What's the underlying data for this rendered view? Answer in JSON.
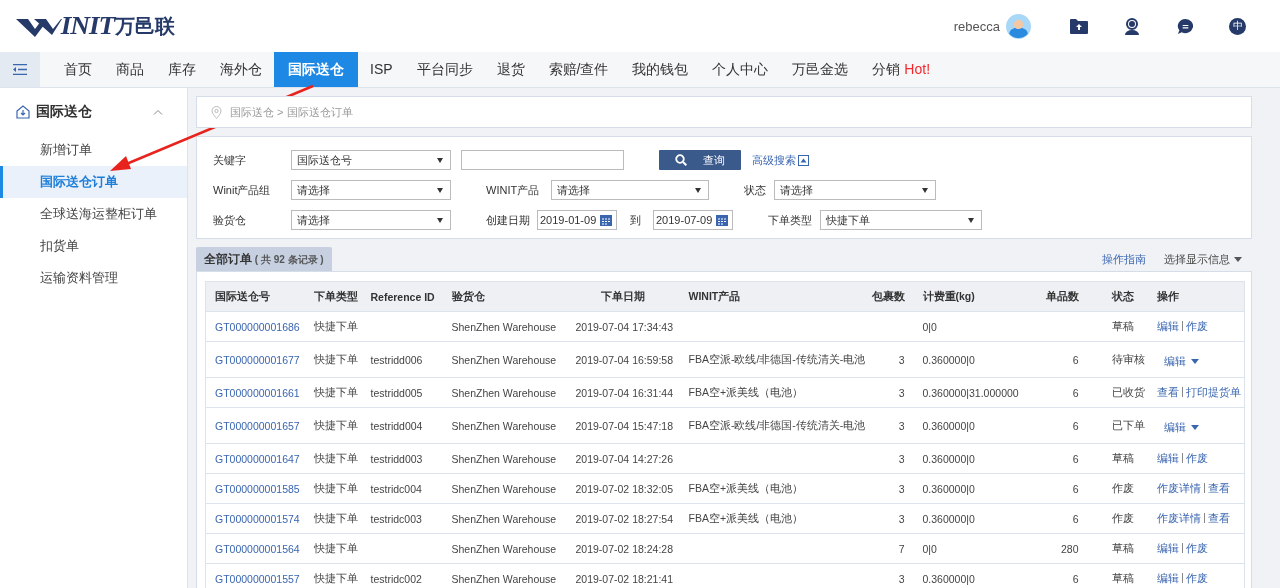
{
  "header": {
    "logo": {
      "mark": "INIT",
      "name": "万邑联"
    },
    "user": "rebecca",
    "language": "中"
  },
  "nav": {
    "tabs": [
      {
        "label": "首页",
        "selected": false
      },
      {
        "label": "商品",
        "selected": false
      },
      {
        "label": "库存",
        "selected": false
      },
      {
        "label": "海外仓",
        "selected": false
      },
      {
        "label": "国际送仓",
        "selected": true
      },
      {
        "label": "ISP",
        "selected": false
      },
      {
        "label": "平台同步",
        "selected": false
      },
      {
        "label": "退货",
        "selected": false
      },
      {
        "label": "索赔/查件",
        "selected": false
      },
      {
        "label": "我的钱包",
        "selected": false
      },
      {
        "label": "个人中心",
        "selected": false
      },
      {
        "label": "万邑金选",
        "selected": false
      },
      {
        "label": "分销",
        "selected": false,
        "badge": "Hot!"
      }
    ]
  },
  "sidebar": {
    "group": {
      "label": "国际送仓",
      "expanded": true
    },
    "items": [
      {
        "label": "新增订单",
        "selected": false
      },
      {
        "label": "国际送仓订单",
        "selected": true
      },
      {
        "label": "全球送海运整柜订单",
        "selected": false
      },
      {
        "label": "扣货单",
        "selected": false
      },
      {
        "label": "运输资料管理",
        "selected": false
      }
    ]
  },
  "breadcrumb": {
    "path": "国际送仓 > 国际送仓订单"
  },
  "filters": {
    "keyword": {
      "label": "关键字",
      "option": "国际送仓号"
    },
    "search_button": "查询",
    "advanced_link": "高级搜索",
    "row2": [
      {
        "label": "Winit产品组",
        "value": "请选择"
      },
      {
        "label": "WINIT产品",
        "value": "请选择"
      },
      {
        "label": "状态",
        "value": "请选择"
      }
    ],
    "warehouse": {
      "label": "验货仓",
      "value": "请选择"
    },
    "date": {
      "label": "创建日期",
      "from": "2019-01-09",
      "to_label": "到",
      "to": "2019-07-09"
    },
    "order_type": {
      "label": "下单类型",
      "value": "快捷下单"
    }
  },
  "orders": {
    "tab": {
      "label": "全部订单",
      "count_text": "( 共 **92** 条记录 )"
    },
    "guide_link": "操作指南",
    "display_menu": "选择显示信息",
    "columns": [
      "国际送仓号",
      "下单类型",
      "Reference ID",
      "验货仓",
      "下单日期",
      "WINIT产品",
      "包裹数",
      "计费重(kg)",
      "单品数",
      "状态",
      "操作"
    ],
    "rows": [
      {
        "id": "GT000000001686",
        "type": "快捷下单",
        "ref": "",
        "warehouse": "ShenZhen Warehouse",
        "date": "2019-07-04 17:34:43",
        "product": "",
        "packages": "",
        "weight": "0|0",
        "items": "",
        "status": "草稿",
        "kind": "links",
        "actions": [
          "编辑",
          "作废"
        ]
      },
      {
        "id": "GT000000001677",
        "type": "快捷下单",
        "ref": "testridd006",
        "warehouse": "ShenZhen Warehouse",
        "date": "2019-07-04 16:59:58",
        "product": "FBA空派-欧线/非德国-传统清关-电池",
        "packages": "3",
        "weight": "0.360000|0",
        "items": "6",
        "status": "待审核",
        "kind": "menu",
        "actions": [
          "编辑"
        ]
      },
      {
        "id": "GT000000001661",
        "type": "快捷下单",
        "ref": "testridd005",
        "warehouse": "ShenZhen Warehouse",
        "date": "2019-07-04 16:31:44",
        "product": "FBA空+派美线（电池）",
        "packages": "3",
        "weight": "0.360000|31.000000",
        "items": "6",
        "status": "已收货",
        "kind": "links",
        "actions": [
          "查看",
          "打印提货单"
        ]
      },
      {
        "id": "GT000000001657",
        "type": "快捷下单",
        "ref": "testridd004",
        "warehouse": "ShenZhen Warehouse",
        "date": "2019-07-04 15:47:18",
        "product": "FBA空派-欧线/非德国-传统清关-电池",
        "packages": "3",
        "weight": "0.360000|0",
        "items": "6",
        "status": "已下单",
        "kind": "menu",
        "actions": [
          "编辑"
        ]
      },
      {
        "id": "GT000000001647",
        "type": "快捷下单",
        "ref": "testridd003",
        "warehouse": "ShenZhen Warehouse",
        "date": "2019-07-04 14:27:26",
        "product": "",
        "packages": "3",
        "weight": "0.360000|0",
        "items": "6",
        "status": "草稿",
        "kind": "links",
        "actions": [
          "编辑",
          "作废"
        ]
      },
      {
        "id": "GT000000001585",
        "type": "快捷下单",
        "ref": "testridc004",
        "warehouse": "ShenZhen Warehouse",
        "date": "2019-07-02 18:32:05",
        "product": "FBA空+派美线（电池）",
        "packages": "3",
        "weight": "0.360000|0",
        "items": "6",
        "status": "作废",
        "kind": "links",
        "actions": [
          "作废详情",
          "查看"
        ]
      },
      {
        "id": "GT000000001574",
        "type": "快捷下单",
        "ref": "testridc003",
        "warehouse": "ShenZhen Warehouse",
        "date": "2019-07-02 18:27:54",
        "product": "FBA空+派美线（电池）",
        "packages": "3",
        "weight": "0.360000|0",
        "items": "6",
        "status": "作废",
        "kind": "links",
        "actions": [
          "作废详情",
          "查看"
        ]
      },
      {
        "id": "GT000000001564",
        "type": "快捷下单",
        "ref": "",
        "warehouse": "ShenZhen Warehouse",
        "date": "2019-07-02 18:24:28",
        "product": "",
        "packages": "7",
        "weight": "0|0",
        "items": "280",
        "status": "草稿",
        "kind": "links",
        "actions": [
          "编辑",
          "作废"
        ]
      },
      {
        "id": "GT000000001557",
        "type": "快捷下单",
        "ref": "testridc002",
        "warehouse": "ShenZhen Warehouse",
        "date": "2019-07-02 18:21:41",
        "product": "",
        "packages": "3",
        "weight": "0.360000|0",
        "items": "6",
        "status": "草稿",
        "kind": "links",
        "actions": [
          "编辑",
          "作废"
        ]
      }
    ]
  }
}
